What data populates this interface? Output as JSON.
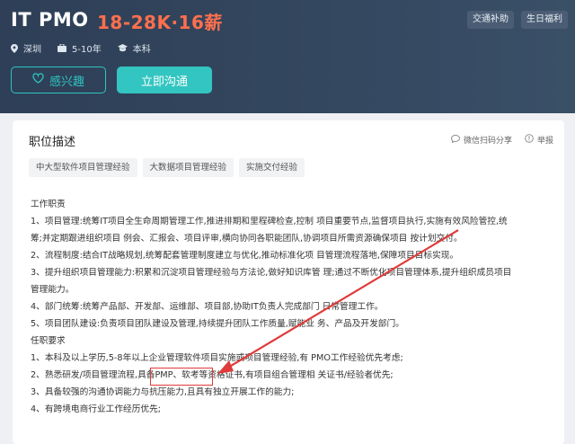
{
  "job": {
    "title": "IT PMO",
    "salary": "18-28K·16薪",
    "perks": [
      "交通补助",
      "生日福利"
    ],
    "location": "深圳",
    "experience": "5-10年",
    "education": "本科"
  },
  "buttons": {
    "interest": "感兴趣",
    "chat": "立即沟通"
  },
  "description": {
    "heading": "职位描述",
    "wechat_share": "微信扫码分享",
    "report": "举报",
    "tags": [
      "中大型软件项目管理经验",
      "大数据项目管理经验",
      "实施交付经验"
    ],
    "lines": [
      "工作职责",
      "1、项目管理:统筹IT项目全生命周期管理工作,推进排期和里程碑检查,控制 项目重要节点,监督项目执行,实施有效风险管控,统",
      "筹;并定期跟进组织项目 例会、汇报会、项目评审,横向协同各职能团队,协调项目所需资源确保项目 按计划交付。",
      "2、流程制度:结合IT战略规划,统筹配套管理制度建立与优化,推动标准化项 目管理流程落地,保障项目目标实现。",
      "3、提升组织项目管理能力:积累和沉淀项目管理经验与方法论,做好知识库管 理;通过不断优化项目管理体系,提升组织成员项目",
      "管理能力。",
      "4、部门统筹:统筹产品部、开发部、运维部、项目部,协助IT负责人完成部门 日常管理工作。",
      "5、项目团队建设:负责项目团队建设及管理,持续提升团队工作质量,赋能业 务、产品及开发部门。",
      "任职要求",
      "1、本科及以上学历,5-8年以上企业管理软件项目实施或项目管理经验,有 PMO工作经验优先考虑;",
      "2、熟悉研发/项目管理流程,具备PMP、软考等资格证书,有项目组合管理相 关证书/经验者优先;",
      "3、具备较强的沟通协调能力与抗压能力,且具有独立开展工作的能力;",
      "4、有跨境电商行业工作经历优先;"
    ]
  },
  "colors": {
    "header_bg": "#2e3f57",
    "salary": "#ff6f4d",
    "accent_teal": "#33c5c1",
    "annotation_red": "#e03a3a"
  }
}
